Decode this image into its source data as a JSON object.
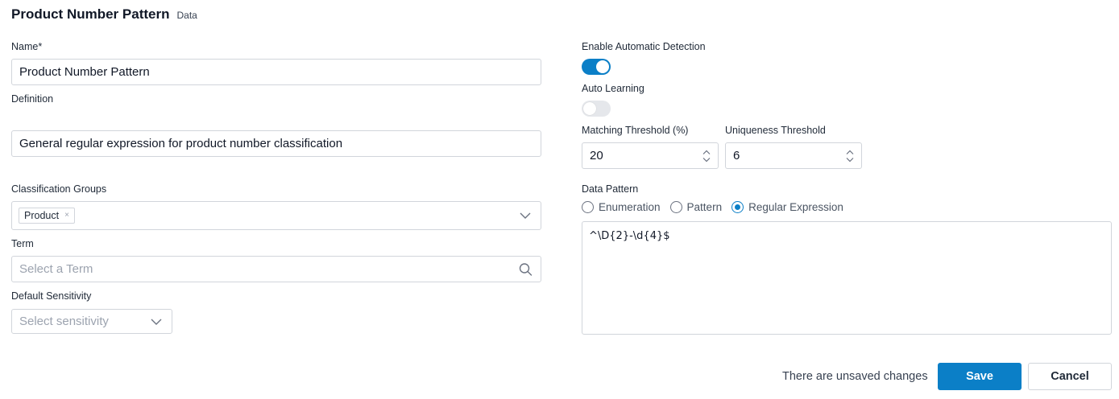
{
  "header": {
    "title": "Product Number Pattern",
    "subtitle": "Data"
  },
  "left": {
    "name": {
      "label": "Name*",
      "value": "Product Number Pattern"
    },
    "definition": {
      "label": "Definition",
      "value": "General regular expression for product number classification"
    },
    "classification_groups": {
      "label": "Classification Groups",
      "tags": [
        "Product"
      ],
      "remove_glyph": "×"
    },
    "term": {
      "label": "Term",
      "placeholder": "Select a Term"
    },
    "default_sensitivity": {
      "label": "Default Sensitivity",
      "placeholder": "Select sensitivity"
    }
  },
  "right": {
    "enable_auto_detection": {
      "label": "Enable Automatic Detection",
      "enabled": true
    },
    "auto_learning": {
      "label": "Auto Learning",
      "enabled": false
    },
    "matching_threshold": {
      "label": "Matching Threshold (%)",
      "value": "20"
    },
    "uniqueness_threshold": {
      "label": "Uniqueness Threshold",
      "value": "6"
    },
    "data_pattern": {
      "label": "Data Pattern",
      "options": [
        "Enumeration",
        "Pattern",
        "Regular Expression"
      ],
      "selected": "Regular Expression",
      "expression": "^\\D{2}-\\d{4}$"
    }
  },
  "footer": {
    "status": "There are unsaved changes",
    "save_label": "Save",
    "cancel_label": "Cancel"
  },
  "colors": {
    "accent": "#0b7fc7",
    "border": "#d1d5db",
    "placeholder": "#9ca3af"
  },
  "icons": {
    "group_dropdown": "chevron-down-icon",
    "term_search": "search-icon",
    "sensitivity_dropdown": "chevron-down-icon",
    "stepper": "chevron-up-down-icon"
  }
}
